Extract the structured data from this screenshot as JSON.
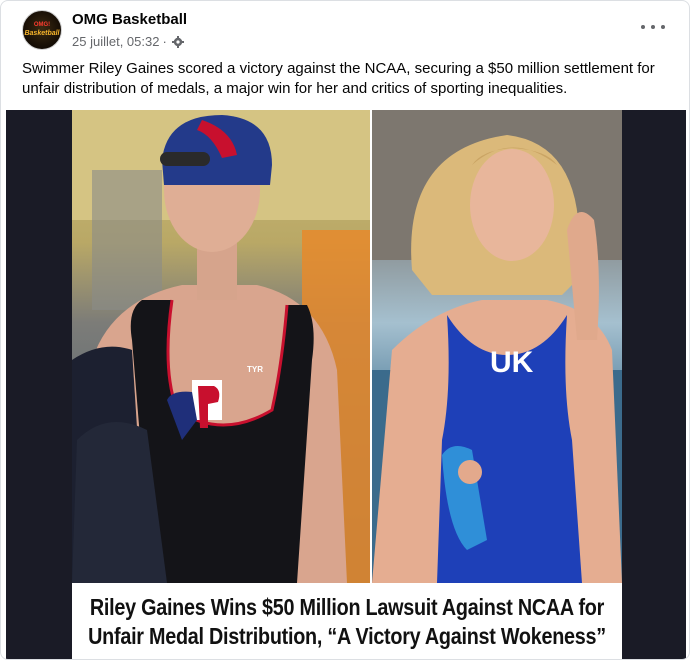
{
  "post": {
    "page_name": "OMG Basketball",
    "avatar": {
      "line1": "OMG!",
      "line2": "Basketball"
    },
    "timestamp": "25 juillet, 05:32",
    "separator": "·",
    "audience_icon": "gear-icon",
    "more_icon": "more-options-icon",
    "caption": "Swimmer Riley Gaines scored a victory against the NCAA, securing a $50 million settlement for unfair distribution of medals, a major win for her and critics of sporting inequalities."
  },
  "image": {
    "left_cap_text": "P",
    "left_suit_brand": "TYR",
    "left_suit_logo": "P",
    "right_suit_logo": "UK",
    "banner_line1": "Riley Gaines Wins $50 Million Lawsuit Against NCAA for",
    "banner_line2": "Unfair Medal Distribution, “A Victory Against Wokeness”"
  },
  "colors": {
    "text_primary": "#050505",
    "text_secondary": "#65676b",
    "penn_red": "#c8102e",
    "penn_blue": "#1f2f7a",
    "kentucky_blue": "#1e40b8"
  }
}
